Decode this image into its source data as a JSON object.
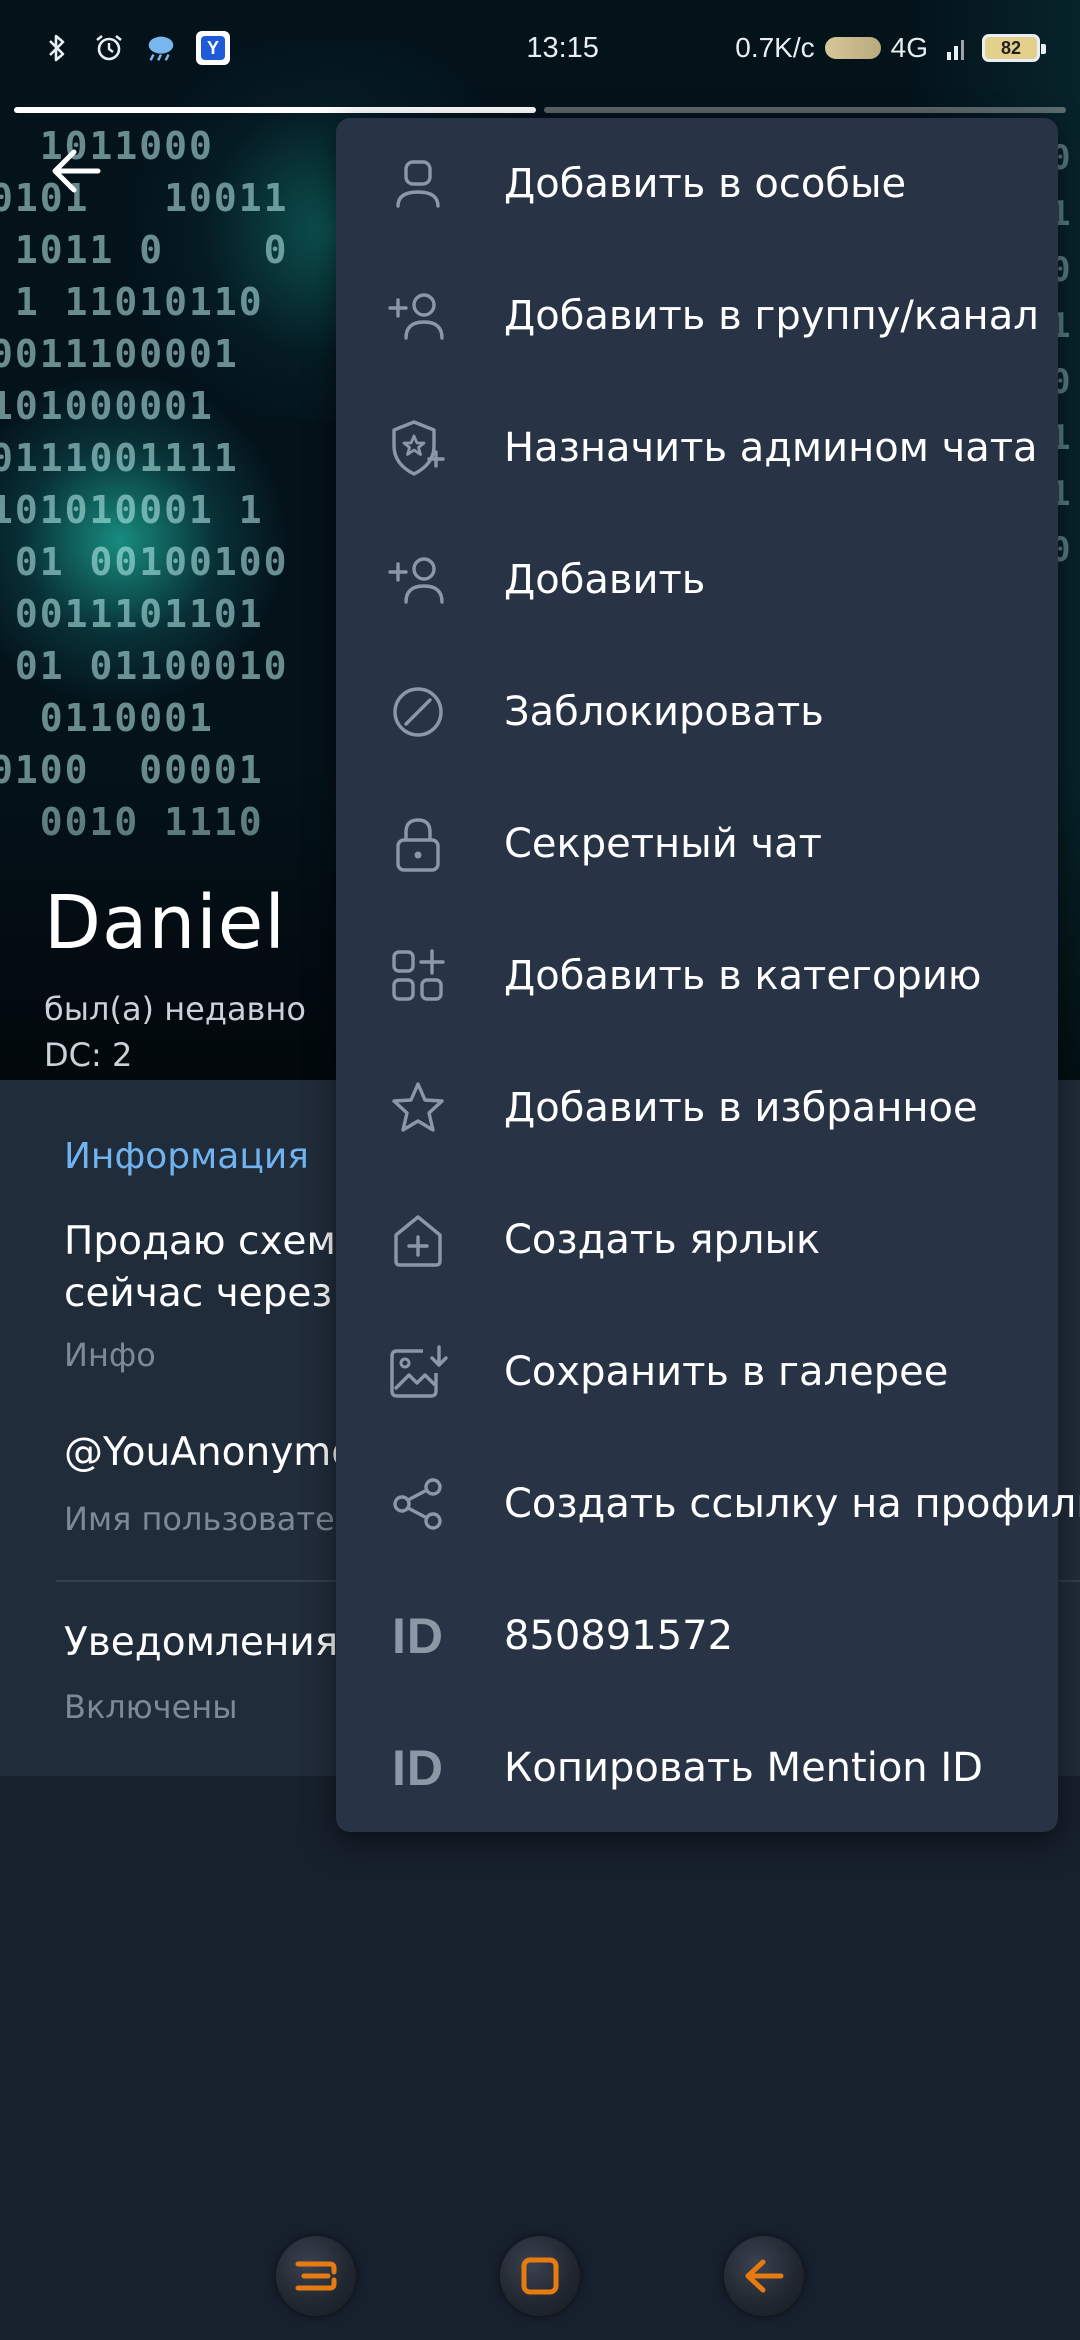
{
  "status_bar": {
    "time": "13:15",
    "network_speed": "0.7K/c",
    "network_type": "4G",
    "battery_level": "82",
    "left_icons": [
      "bluetooth-icon",
      "alarm-icon",
      "weather-icon",
      "app-badge-icon"
    ]
  },
  "story_progress": {
    "segments": 2,
    "active": 1
  },
  "profile": {
    "name": "Daniel",
    "status": "был(а) недавно",
    "dc": "DC: 2"
  },
  "info": {
    "heading": "Информация",
    "bio_line1": "Продаю схему",
    "bio_line2": "сейчас через м",
    "bio_label": "Инфо",
    "username": "@YouAnonymo",
    "username_label": "Имя пользователя",
    "notifications_title": "Уведомления",
    "notifications_value": "Включены"
  },
  "menu": {
    "items": [
      {
        "icon": "person-icon",
        "label": "Добавить в особые"
      },
      {
        "icon": "add-user-icon",
        "label": "Добавить в группу/канал"
      },
      {
        "icon": "admin-shield-icon",
        "label": "Назначить админом чата"
      },
      {
        "icon": "add-user-icon",
        "label": "Добавить"
      },
      {
        "icon": "block-icon",
        "label": "Заблокировать"
      },
      {
        "icon": "lock-icon",
        "label": "Секретный чат"
      },
      {
        "icon": "category-add-icon",
        "label": "Добавить в категорию"
      },
      {
        "icon": "star-icon",
        "label": "Добавить в избранное"
      },
      {
        "icon": "shortcut-icon",
        "label": "Создать ярлык"
      },
      {
        "icon": "save-gallery-icon",
        "label": "Сохранить в галерее"
      },
      {
        "icon": "share-icon",
        "label": "Создать ссылку на профиль"
      },
      {
        "icon": "id-icon",
        "label": "850891572",
        "glyph": "ID"
      },
      {
        "icon": "id-icon",
        "label": "Копировать Mention ID",
        "glyph": "ID"
      }
    ]
  },
  "colors": {
    "background": "#17202d",
    "info_section": "#212c3a",
    "menu_background": "#283445",
    "accent": "#6fb4f0",
    "secondary_text": "#7d8996",
    "menu_icon": "#8b98a6",
    "nav_accent": "#e77b12"
  },
  "nav_bar": {
    "buttons": [
      "recents-button",
      "home-button",
      "back-button"
    ]
  }
}
